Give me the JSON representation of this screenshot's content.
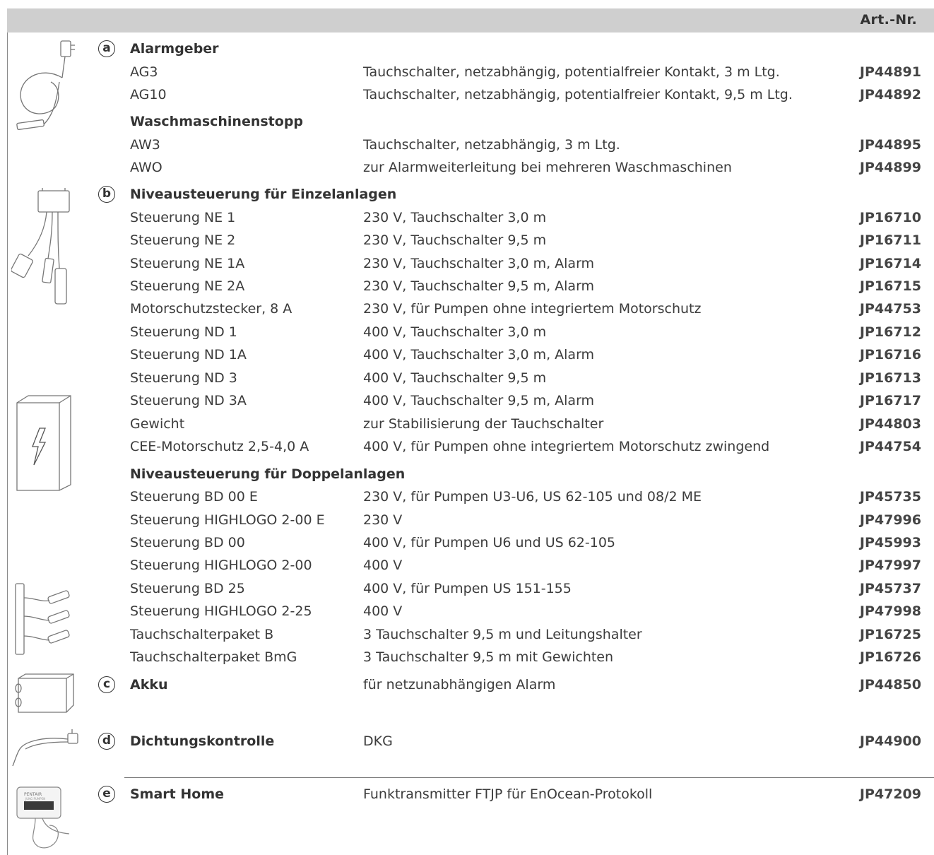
{
  "header": {
    "art_nr_label": "Art.-Nr."
  },
  "sections": {
    "a": {
      "letter": "a",
      "title": "Alarmgeber"
    },
    "b": {
      "letter": "b",
      "title": "Niveausteuerung für Einzelanlagen"
    },
    "c": {
      "letter": "c",
      "title": "Akku",
      "desc": "für netzunabhängigen Alarm",
      "art": "JP44850"
    },
    "d": {
      "letter": "d",
      "title": "Dichtungskontrolle",
      "desc": "DKG",
      "art": "JP44900"
    },
    "e": {
      "letter": "e",
      "title": "Smart Home",
      "desc": "Funktransmitter FTJP für EnOcean-Protokoll",
      "art": "JP47209"
    }
  },
  "subheadings": {
    "waschmaschinenstopp": "Waschmaschinenstopp",
    "doppelanlagen": "Niveausteuerung für Doppelanlagen"
  },
  "rows": [
    {
      "name": "AG3",
      "desc": "Tauchschalter, netzabhängig, potentialfreier Kontakt, 3 m Ltg.",
      "art": "JP44891"
    },
    {
      "name": "AG10",
      "desc": "Tauchschalter, netzabhängig, potentialfreier Kontakt, 9,5 m Ltg.",
      "art": "JP44892"
    },
    {
      "name": "AW3",
      "desc": "Tauchschalter, netzabhängig, 3 m Ltg.",
      "art": "JP44895"
    },
    {
      "name": "AWO",
      "desc": "zur Alarmweiterleitung bei mehreren Waschmaschinen",
      "art": "JP44899"
    },
    {
      "name": "Steuerung NE 1",
      "desc": "230 V, Tauchschalter 3,0 m",
      "art": "JP16710"
    },
    {
      "name": "Steuerung NE 2",
      "desc": "230 V, Tauchschalter 9,5 m",
      "art": "JP16711"
    },
    {
      "name": "Steuerung NE 1A",
      "desc": "230 V, Tauchschalter 3,0 m, Alarm",
      "art": "JP16714"
    },
    {
      "name": "Steuerung NE 2A",
      "desc": "230 V, Tauchschalter 9,5 m, Alarm",
      "art": "JP16715"
    },
    {
      "name": "Motorschutzstecker, 8 A",
      "desc": "230 V, für Pumpen ohne integriertem Motorschutz",
      "art": "JP44753"
    },
    {
      "name": "Steuerung ND 1",
      "desc": "400 V, Tauchschalter 3,0 m",
      "art": "JP16712"
    },
    {
      "name": "Steuerung ND 1A",
      "desc": "400 V, Tauchschalter 3,0 m, Alarm",
      "art": "JP16716"
    },
    {
      "name": "Steuerung ND 3",
      "desc": "400 V, Tauchschalter 9,5 m",
      "art": "JP16713"
    },
    {
      "name": "Steuerung ND 3A",
      "desc": "400 V, Tauchschalter 9,5 m, Alarm",
      "art": "JP16717"
    },
    {
      "name": "Gewicht",
      "desc": "zur Stabilisierung der Tauchschalter",
      "art": "JP44803"
    },
    {
      "name": "CEE-Motorschutz 2,5-4,0 A",
      "desc": "400 V,  für Pumpen ohne integriertem Motorschutz zwingend",
      "art": "JP44754"
    },
    {
      "name": "Steuerung BD 00 E",
      "desc": "230 V, für Pumpen U3-U6, US 62-105 und 08/2 ME",
      "art": "JP45735"
    },
    {
      "name": "Steuerung HIGHLOGO 2-00 E",
      "desc": "230 V",
      "art": "JP47996"
    },
    {
      "name": "Steuerung BD 00",
      "desc": "400 V, für Pumpen U6 und US 62-105",
      "art": "JP45993"
    },
    {
      "name": "Steuerung HIGHLOGO 2-00",
      "desc": "400 V",
      "art": "JP47997"
    },
    {
      "name": "Steuerung BD 25",
      "desc": "400 V, für Pumpen US 151-155",
      "art": "JP45737"
    },
    {
      "name": "Steuerung HIGHLOGO 2-25",
      "desc": "400 V",
      "art": "JP47998"
    },
    {
      "name": "Tauchschalterpaket B",
      "desc": "3 Tauchschalter 9,5 m und Leitungshalter",
      "art": "JP16725"
    },
    {
      "name": "Tauchschalterpaket BmG",
      "desc": "3 Tauchschalter 9,5 m mit Gewichten",
      "art": "JP16726"
    }
  ],
  "illustrations": {
    "e_device_label": "PENTAIR",
    "e_device_sublabel": "JUNG PUMPEN"
  }
}
